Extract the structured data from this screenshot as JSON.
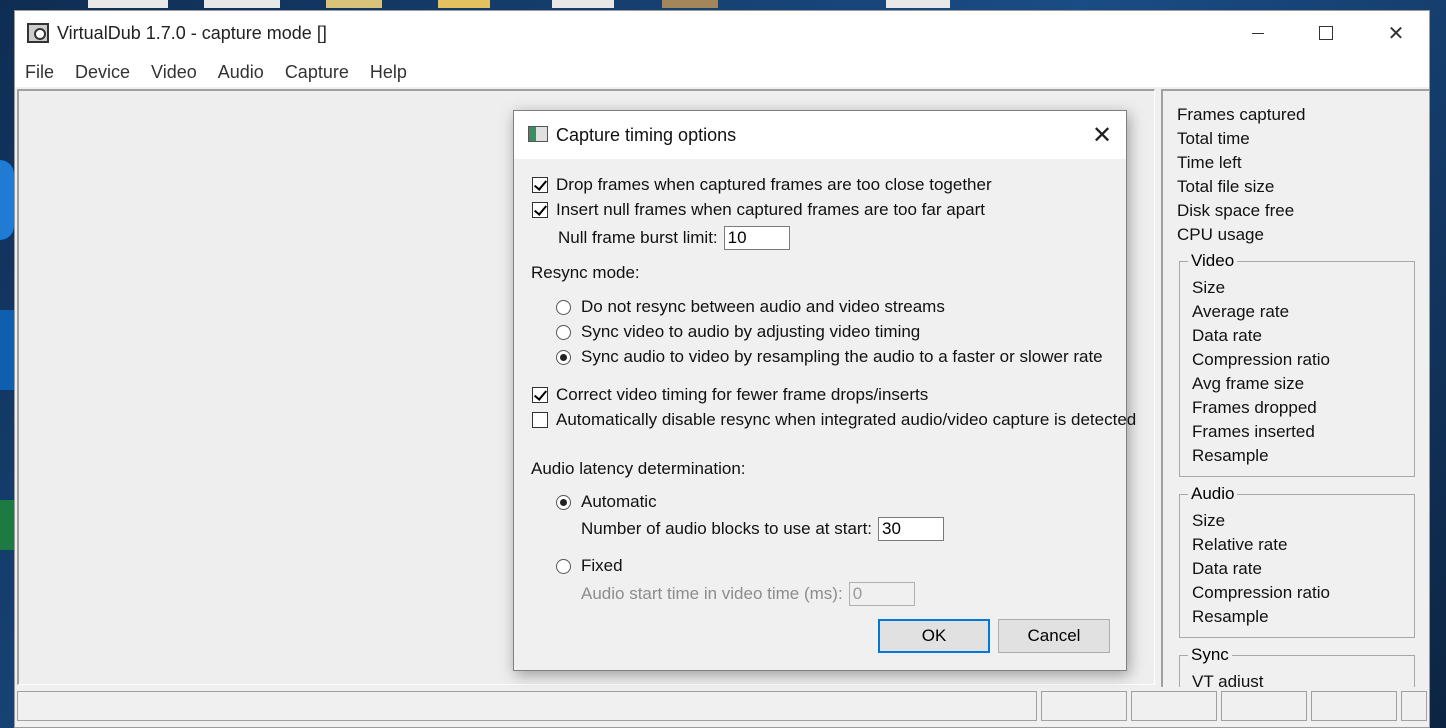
{
  "window": {
    "title": "VirtualDub 1.7.0 - capture mode []"
  },
  "menu": {
    "items": [
      "File",
      "Device",
      "Video",
      "Audio",
      "Capture",
      "Help"
    ]
  },
  "side_panel": {
    "stats": [
      "Frames captured",
      "Total time",
      "Time left",
      "Total file size",
      "Disk space free",
      "CPU usage"
    ],
    "video_group": {
      "title": "Video",
      "items": [
        "Size",
        "Average rate",
        "Data rate",
        "Compression ratio",
        "Avg frame size",
        "Frames dropped",
        "Frames inserted",
        "Resample"
      ]
    },
    "audio_group": {
      "title": "Audio",
      "items": [
        "Size",
        "Relative rate",
        "Data rate",
        "Compression ratio",
        "Resample"
      ]
    },
    "sync_group": {
      "title": "Sync",
      "items": [
        "VT adjust"
      ]
    }
  },
  "dialog": {
    "title": "Capture timing options",
    "drop_frames": {
      "label": "Drop frames when captured frames are too close together",
      "checked": true
    },
    "insert_null": {
      "label": "Insert null frames when captured frames are too far apart",
      "checked": true
    },
    "null_burst": {
      "label": "Null frame burst limit:",
      "value": "10"
    },
    "resync_heading": "Resync mode:",
    "resync_options": [
      {
        "label": "Do not resync between audio and video streams",
        "selected": false
      },
      {
        "label": "Sync video to audio by adjusting video timing",
        "selected": false
      },
      {
        "label": "Sync audio to video by resampling the audio to a faster or slower rate",
        "selected": true
      }
    ],
    "correct_timing": {
      "label": "Correct video timing for fewer frame drops/inserts",
      "checked": true
    },
    "auto_disable": {
      "label": "Automatically disable resync when integrated audio/video capture is detected",
      "checked": false
    },
    "latency_heading": "Audio latency determination:",
    "automatic": {
      "label": "Automatic",
      "selected": true
    },
    "audio_blocks": {
      "label": "Number of audio blocks to use at start:",
      "value": "30"
    },
    "fixed": {
      "label": "Fixed",
      "selected": false
    },
    "audio_start": {
      "label": "Audio start time in video time (ms):",
      "value": "0"
    },
    "ok_label": "OK",
    "cancel_label": "Cancel"
  }
}
